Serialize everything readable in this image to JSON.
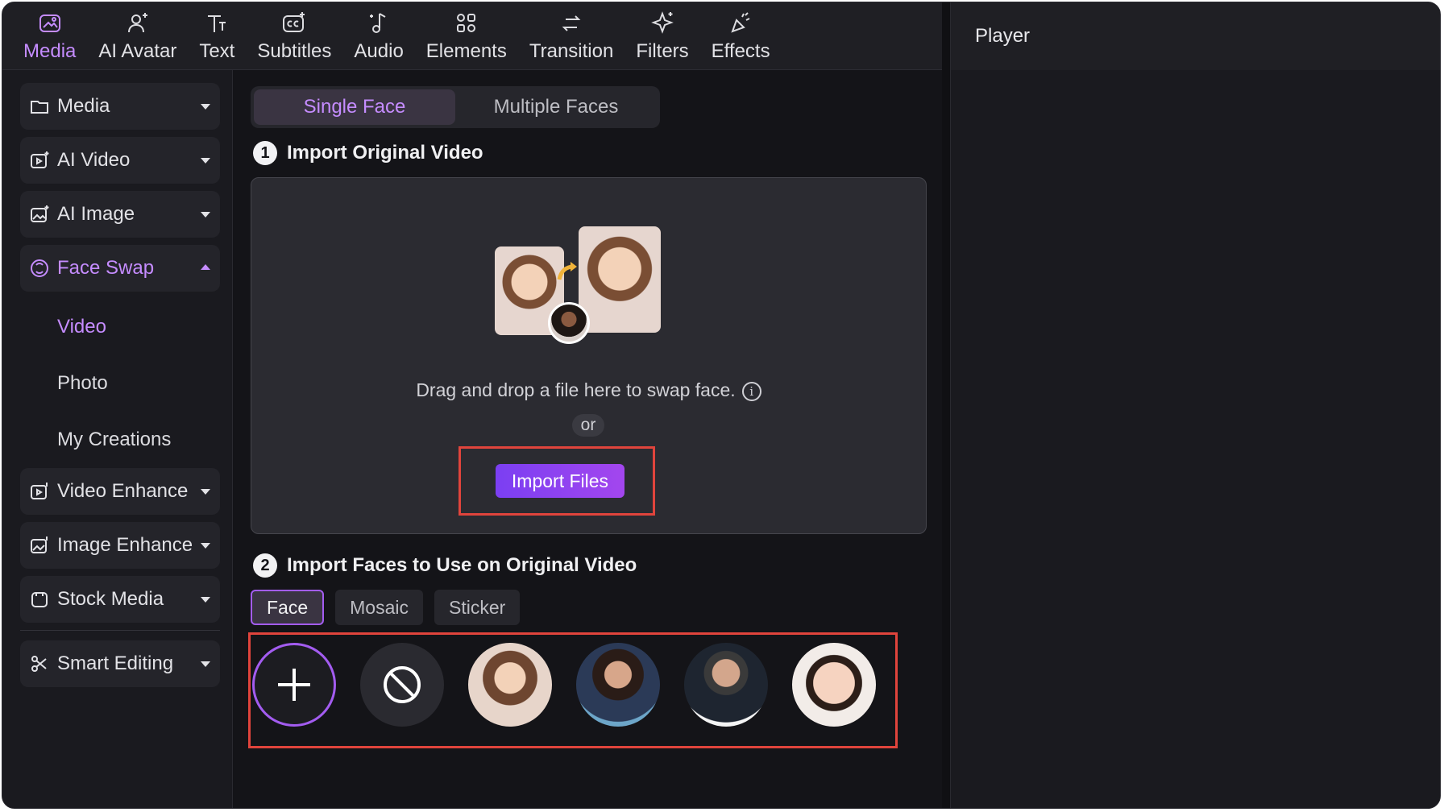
{
  "toolbar": {
    "items": [
      {
        "label": "Media",
        "icon": "media-icon",
        "active": true
      },
      {
        "label": "AI Avatar",
        "icon": "ai-avatar-icon"
      },
      {
        "label": "Text",
        "icon": "text-icon"
      },
      {
        "label": "Subtitles",
        "icon": "subtitles-icon"
      },
      {
        "label": "Audio",
        "icon": "audio-icon"
      },
      {
        "label": "Elements",
        "icon": "elements-icon"
      },
      {
        "label": "Transition",
        "icon": "transition-icon"
      },
      {
        "label": "Filters",
        "icon": "filters-icon"
      },
      {
        "label": "Effects",
        "icon": "effects-icon"
      }
    ]
  },
  "sidebar": {
    "items": [
      {
        "label": "Media",
        "icon": "folder-icon"
      },
      {
        "label": "AI Video",
        "icon": "ai-video-icon"
      },
      {
        "label": "AI Image",
        "icon": "ai-image-icon"
      },
      {
        "label": "Face Swap",
        "icon": "face-swap-icon",
        "expanded": true
      },
      {
        "label": "Video Enhance",
        "icon": "video-enhance-icon"
      },
      {
        "label": "Image Enhance",
        "icon": "image-enhance-icon"
      },
      {
        "label": "Stock Media",
        "icon": "stock-media-icon"
      },
      {
        "label": "Smart Editing",
        "icon": "smart-editing-icon"
      }
    ],
    "face_swap_sub": [
      {
        "label": "Video",
        "active": true
      },
      {
        "label": "Photo"
      },
      {
        "label": "My Creations"
      }
    ]
  },
  "main": {
    "tabs": [
      "Single Face",
      "Multiple Faces"
    ],
    "step1": {
      "number": "1",
      "title": "Import Original Video"
    },
    "dropzone": {
      "text": "Drag and drop a file here to swap face.",
      "info_icon": "i",
      "or": "or",
      "import_button": "Import Files"
    },
    "step2": {
      "number": "2",
      "title": "Import Faces to Use on Original Video"
    },
    "chips": [
      "Face",
      "Mosaic",
      "Sticker"
    ],
    "faces": [
      "add-face-icon",
      "no-face-icon",
      "face-woman-light",
      "face-woman-suit",
      "face-man-glasses",
      "face-baby"
    ]
  },
  "player": {
    "title": "Player"
  },
  "colors": {
    "accent": "#c58cff",
    "button_start": "#7b3ff2",
    "button_end": "#a346ee",
    "highlight": "#e0443c"
  }
}
